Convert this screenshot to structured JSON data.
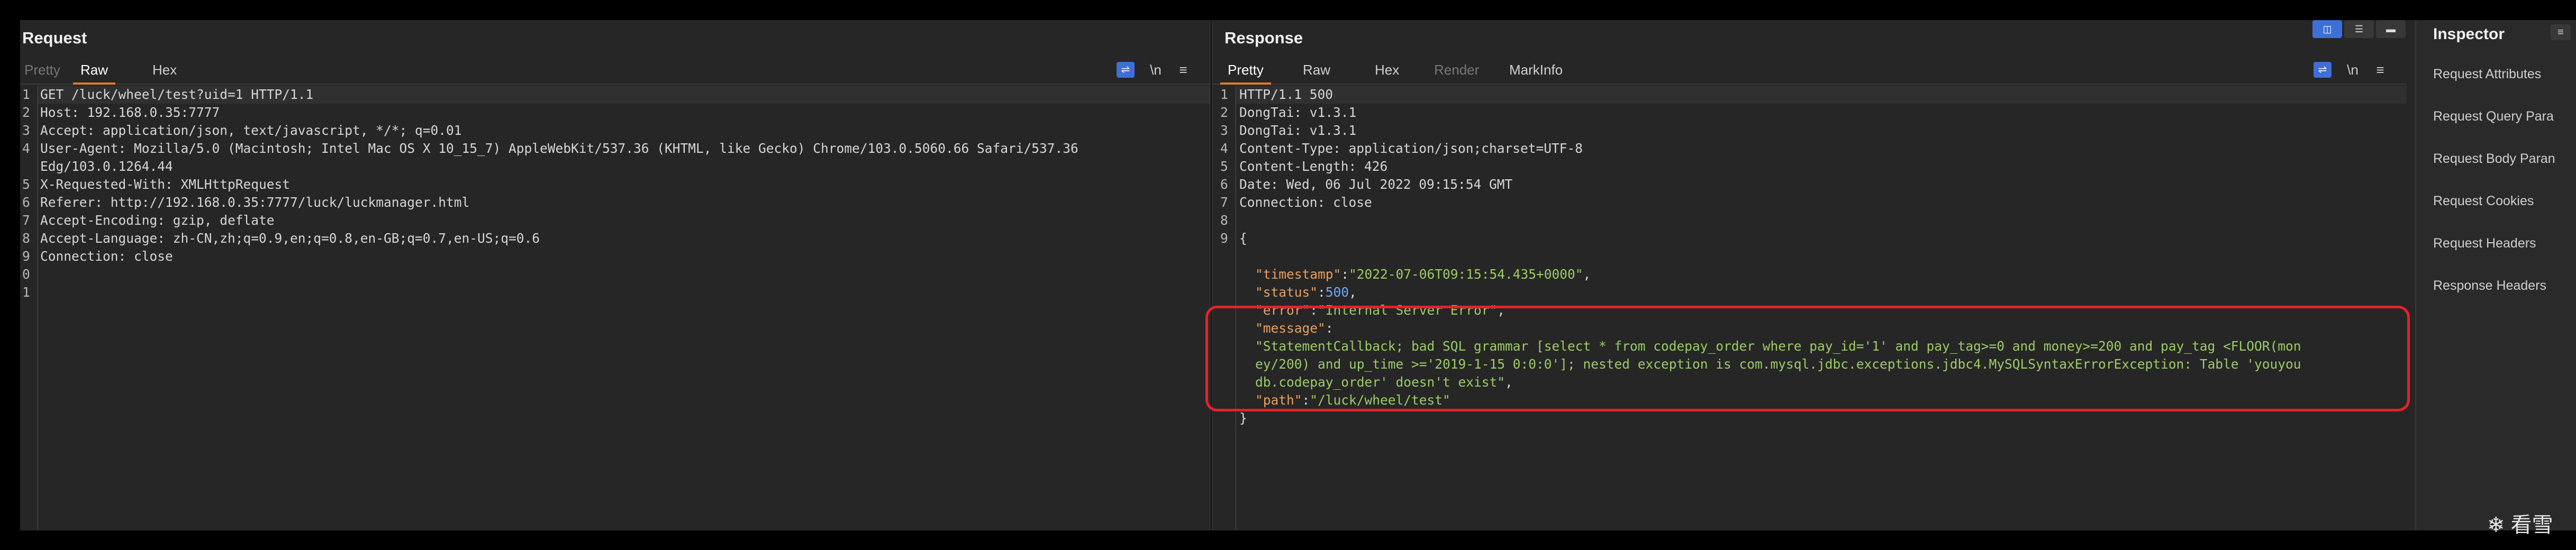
{
  "request": {
    "title": "Request",
    "tabs": [
      "Pretty",
      "Raw",
      "Hex"
    ],
    "active_tab": "Raw",
    "tools": {
      "wrap_icon": "⇌",
      "newline": "\\n",
      "menu": "≡"
    },
    "lines": [
      {
        "n": "1",
        "text": "GET /luck/wheel/test?uid=1 HTTP/1.1"
      },
      {
        "n": "2",
        "text": "Host: 192.168.0.35:7777"
      },
      {
        "n": "3",
        "text": "Accept: application/json, text/javascript, */*; q=0.01"
      },
      {
        "n": "4",
        "text": "User-Agent: Mozilla/5.0 (Macintosh; Intel Mac OS X 10_15_7) AppleWebKit/537.36 (KHTML, like Gecko) Chrome/103.0.5060.66 Safari/537.36"
      },
      {
        "n": "",
        "text": "Edg/103.0.1264.44"
      },
      {
        "n": "5",
        "text": "X-Requested-With: XMLHttpRequest"
      },
      {
        "n": "6",
        "text": "Referer: http://192.168.0.35:7777/luck/luckmanager.html"
      },
      {
        "n": "7",
        "text": "Accept-Encoding: gzip, deflate"
      },
      {
        "n": "8",
        "text": "Accept-Language: zh-CN,zh;q=0.9,en;q=0.8,en-GB;q=0.7,en-US;q=0.6"
      },
      {
        "n": "9",
        "text": "Connection: close"
      },
      {
        "n": "0",
        "text": ""
      },
      {
        "n": "1",
        "text": ""
      }
    ]
  },
  "response": {
    "title": "Response",
    "tabs": [
      "Pretty",
      "Raw",
      "Hex",
      "Render",
      "MarkInfo"
    ],
    "active_tab": "Pretty",
    "tools": {
      "wrap_icon": "⇌",
      "newline": "\\n",
      "menu": "≡"
    },
    "header_lines": [
      {
        "n": "1",
        "text": "HTTP/1.1 500"
      },
      {
        "n": "2",
        "text": "DongTai: v1.3.1"
      },
      {
        "n": "3",
        "text": "DongTai: v1.3.1"
      },
      {
        "n": "4",
        "text": "Content-Type: application/json;charset=UTF-8"
      },
      {
        "n": "5",
        "text": "Content-Length: 426"
      },
      {
        "n": "6",
        "text": "Date: Wed, 06 Jul 2022 09:15:54 GMT"
      },
      {
        "n": "7",
        "text": "Connection: close"
      },
      {
        "n": "8",
        "text": ""
      },
      {
        "n": "9",
        "text": "{"
      }
    ],
    "json": {
      "timestamp_key": "\"timestamp\"",
      "timestamp_val": "\"2022-07-06T09:15:54.435+0000\"",
      "status_key": "\"status\"",
      "status_val": "500",
      "error_key": "\"error\"",
      "error_val": "\"Internal Server Error\"",
      "message_key": "\"message\"",
      "message_line1": "\"StatementCallback; bad SQL grammar [select * from codepay_order where pay_id='1' and pay_tag>=0 and money>=200 and pay_tag <FLOOR(mon",
      "message_line2": "ey/200) and up_time >='2019-1-15 0:0:0']; nested exception is com.mysql.jdbc.exceptions.jdbc4.MySQLSyntaxErrorException: Table 'youyou",
      "message_line3": "db.codepay_order' doesn't exist\"",
      "path_key": "\"path\"",
      "path_val": "\"/luck/wheel/test\"",
      "close": "}"
    }
  },
  "inspector": {
    "title": "Inspector",
    "menu_icon": "≡",
    "items": [
      "Request Attributes",
      "Request Query Para",
      "Request Body Paran",
      "Request Cookies",
      "Request Headers",
      "Response Headers"
    ]
  },
  "layout_icons": {
    "split_horizontal": "◫",
    "split_vertical": "☰",
    "single": "▬"
  },
  "watermark": "❄ 看雪"
}
